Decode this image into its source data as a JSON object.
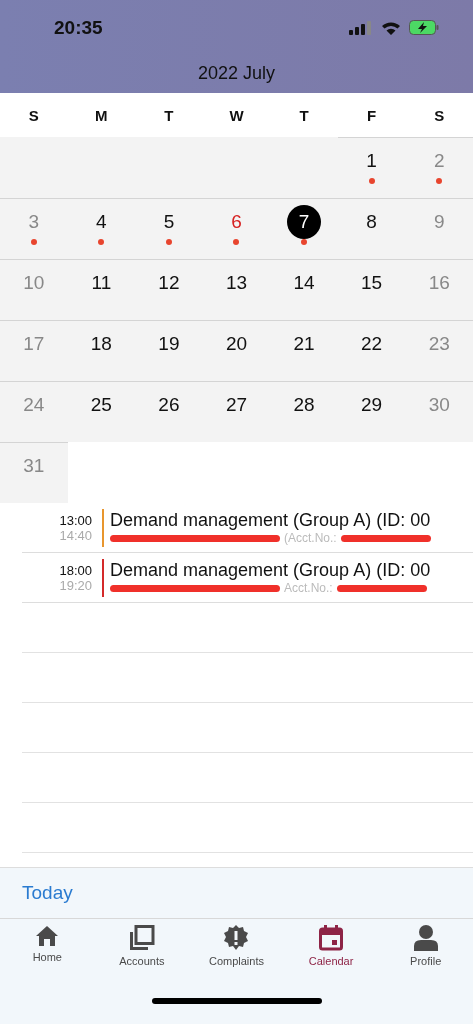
{
  "status_bar": {
    "time": "20:35"
  },
  "header": {
    "title": "2022 July"
  },
  "weekdays": [
    {
      "label": "S"
    },
    {
      "label": "M"
    },
    {
      "label": "T"
    },
    {
      "label": "W"
    },
    {
      "label": "T"
    },
    {
      "label": "F"
    },
    {
      "label": "S"
    }
  ],
  "days": [
    {
      "kind": "blank"
    },
    {
      "kind": "blank"
    },
    {
      "kind": "blank"
    },
    {
      "kind": "blank"
    },
    {
      "kind": "blank"
    },
    {
      "kind": "day",
      "label": "1",
      "weekend": false,
      "holiday": false,
      "selected": false,
      "has_event": true
    },
    {
      "kind": "day",
      "label": "2",
      "weekend": true,
      "holiday": false,
      "selected": false,
      "has_event": true
    },
    {
      "kind": "day",
      "label": "3",
      "weekend": true,
      "holiday": false,
      "selected": false,
      "has_event": true
    },
    {
      "kind": "day",
      "label": "4",
      "weekend": false,
      "holiday": false,
      "selected": false,
      "has_event": true
    },
    {
      "kind": "day",
      "label": "5",
      "weekend": false,
      "holiday": false,
      "selected": false,
      "has_event": true
    },
    {
      "kind": "day",
      "label": "6",
      "weekend": false,
      "holiday": true,
      "selected": false,
      "has_event": true
    },
    {
      "kind": "day",
      "label": "7",
      "weekend": false,
      "holiday": false,
      "selected": true,
      "has_event": true
    },
    {
      "kind": "day",
      "label": "8",
      "weekend": false,
      "holiday": false,
      "selected": false,
      "has_event": false
    },
    {
      "kind": "day",
      "label": "9",
      "weekend": true,
      "holiday": false,
      "selected": false,
      "has_event": false
    },
    {
      "kind": "day",
      "label": "10",
      "weekend": true,
      "holiday": false,
      "selected": false,
      "has_event": false
    },
    {
      "kind": "day",
      "label": "11",
      "weekend": false,
      "holiday": false,
      "selected": false,
      "has_event": false
    },
    {
      "kind": "day",
      "label": "12",
      "weekend": false,
      "holiday": false,
      "selected": false,
      "has_event": false
    },
    {
      "kind": "day",
      "label": "13",
      "weekend": false,
      "holiday": false,
      "selected": false,
      "has_event": false
    },
    {
      "kind": "day",
      "label": "14",
      "weekend": false,
      "holiday": false,
      "selected": false,
      "has_event": false
    },
    {
      "kind": "day",
      "label": "15",
      "weekend": false,
      "holiday": false,
      "selected": false,
      "has_event": false
    },
    {
      "kind": "day",
      "label": "16",
      "weekend": true,
      "holiday": false,
      "selected": false,
      "has_event": false
    },
    {
      "kind": "day",
      "label": "17",
      "weekend": true,
      "holiday": false,
      "selected": false,
      "has_event": false
    },
    {
      "kind": "day",
      "label": "18",
      "weekend": false,
      "holiday": false,
      "selected": false,
      "has_event": false
    },
    {
      "kind": "day",
      "label": "19",
      "weekend": false,
      "holiday": false,
      "selected": false,
      "has_event": false
    },
    {
      "kind": "day",
      "label": "20",
      "weekend": false,
      "holiday": false,
      "selected": false,
      "has_event": false
    },
    {
      "kind": "day",
      "label": "21",
      "weekend": false,
      "holiday": false,
      "selected": false,
      "has_event": false
    },
    {
      "kind": "day",
      "label": "22",
      "weekend": false,
      "holiday": false,
      "selected": false,
      "has_event": false
    },
    {
      "kind": "day",
      "label": "23",
      "weekend": true,
      "holiday": false,
      "selected": false,
      "has_event": false
    },
    {
      "kind": "day",
      "label": "24",
      "weekend": true,
      "holiday": false,
      "selected": false,
      "has_event": false
    },
    {
      "kind": "day",
      "label": "25",
      "weekend": false,
      "holiday": false,
      "selected": false,
      "has_event": false
    },
    {
      "kind": "day",
      "label": "26",
      "weekend": false,
      "holiday": false,
      "selected": false,
      "has_event": false
    },
    {
      "kind": "day",
      "label": "27",
      "weekend": false,
      "holiday": false,
      "selected": false,
      "has_event": false
    },
    {
      "kind": "day",
      "label": "28",
      "weekend": false,
      "holiday": false,
      "selected": false,
      "has_event": false
    },
    {
      "kind": "day",
      "label": "29",
      "weekend": false,
      "holiday": false,
      "selected": false,
      "has_event": false
    },
    {
      "kind": "day",
      "label": "30",
      "weekend": true,
      "holiday": false,
      "selected": false,
      "has_event": false
    },
    {
      "kind": "day",
      "label": "31",
      "weekend": true,
      "holiday": false,
      "selected": false,
      "has_event": false
    }
  ],
  "events": [
    {
      "start": "13:00",
      "end": "14:40",
      "color": "#e8962e",
      "title": "Demand management (Group A) (ID: 00",
      "subtitle": "(Acct.No.:"
    },
    {
      "start": "18:00",
      "end": "19:20",
      "color": "#d42a2a",
      "title": "Demand management (Group A) (ID: 00",
      "subtitle": "Acct.No.:"
    }
  ],
  "today_button": "Today",
  "tabs": [
    {
      "kind": "home",
      "label": "Home",
      "selected": false
    },
    {
      "kind": "accounts",
      "label": "Accounts",
      "selected": false
    },
    {
      "kind": "complaints",
      "label": "Complaints",
      "selected": false
    },
    {
      "kind": "calendar",
      "label": "Calendar",
      "selected": true
    },
    {
      "kind": "profile",
      "label": "Profile",
      "selected": false
    }
  ]
}
